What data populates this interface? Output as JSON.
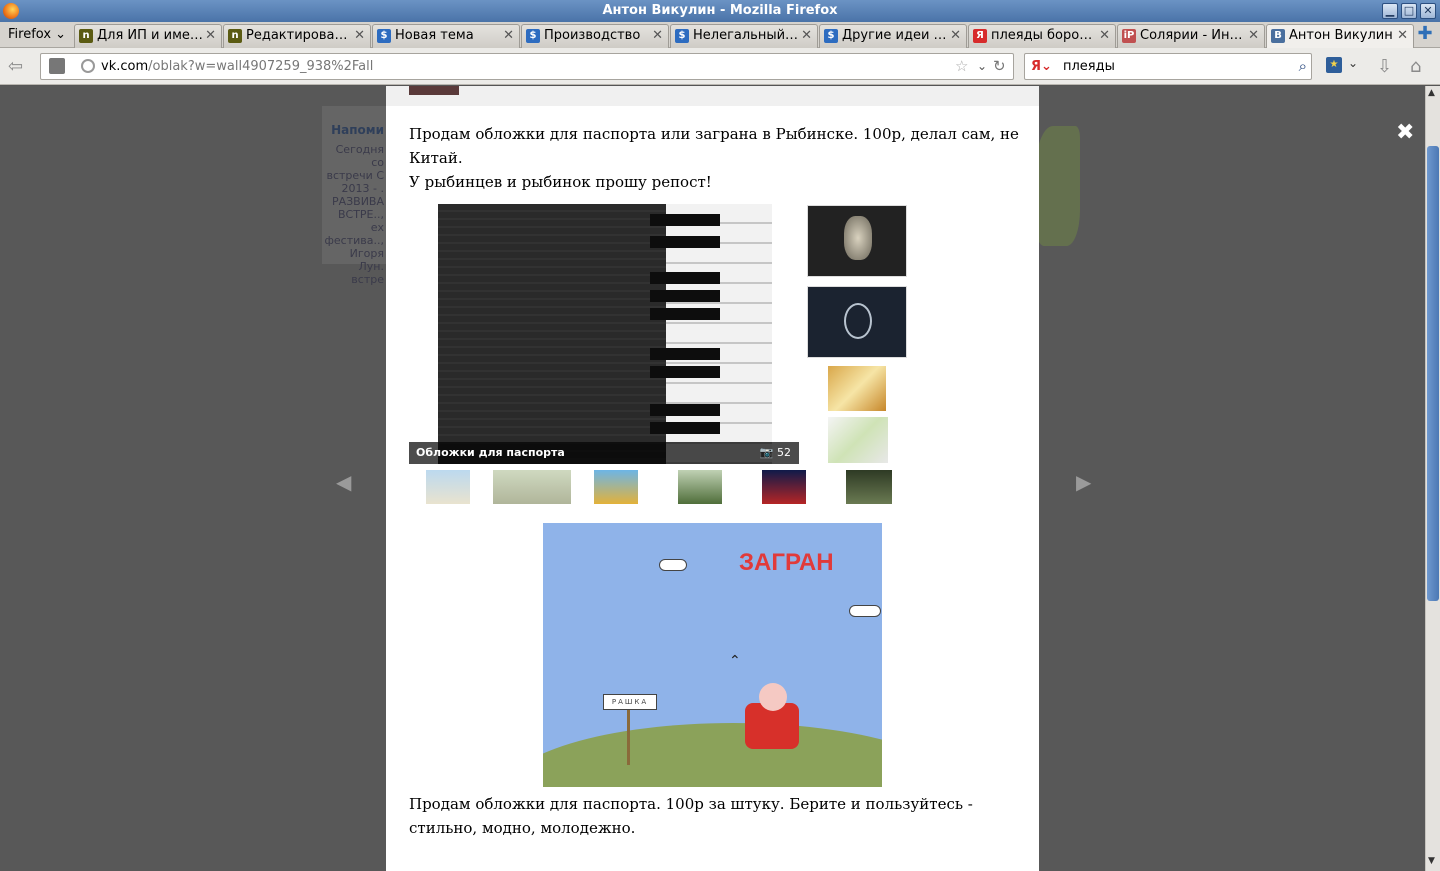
{
  "window": {
    "title": "Антон Викулин - Mozilla Firefox"
  },
  "tabs": {
    "menu_label": "Firefox",
    "items": [
      {
        "label": "Для ИП и име…",
        "icon_color": "#5b5b12",
        "icon_glyph": "n"
      },
      {
        "label": "Редактирова…",
        "icon_color": "#5b5b12",
        "icon_glyph": "n"
      },
      {
        "label": "Новая тема",
        "icon_color": "#2d6cc0",
        "icon_glyph": "$"
      },
      {
        "label": "Производство",
        "icon_color": "#2d6cc0",
        "icon_glyph": "$"
      },
      {
        "label": "Нелегальный…",
        "icon_color": "#2d6cc0",
        "icon_glyph": "$"
      },
      {
        "label": "Другие идеи …",
        "icon_color": "#2d6cc0",
        "icon_glyph": "$"
      },
      {
        "label": "плеяды боро…",
        "icon_color": "#d72b2b",
        "icon_glyph": "Я"
      },
      {
        "label": "Солярии - Ин…",
        "icon_color": "#c05050",
        "icon_glyph": "iP"
      },
      {
        "label": "Антон Викулин",
        "icon_color": "#4a6f9e",
        "icon_glyph": "В"
      }
    ]
  },
  "navbar": {
    "url_host": "vk.com",
    "url_path": "/oblak?w=wall4907259_938%2Fall",
    "search_value": "плеяды"
  },
  "background": {
    "header": "Напоми",
    "lines": [
      "Сегодня со",
      "встречи С",
      "2013 - .",
      "РАЗВИВА",
      "ВСТРЕ.., ех",
      "фестива..,",
      "Игоря Лун.",
      "встре"
    ]
  },
  "post": {
    "text1": "Продам обложки для паспорта или заграна в Рыбинске. 100р, делал сам, не Китай.",
    "text2": "У рыбинцев и рыбинок прошу репост!",
    "album_title": "Обложки для паспорта",
    "album_count": "52",
    "comic_title": "ЗАГРАН",
    "comic_sign": "РАШКА",
    "text3": "Продам обложки для паспорта. 100р за штуку. Берите и пользуйтесь - стильно, модно, молодежно."
  }
}
